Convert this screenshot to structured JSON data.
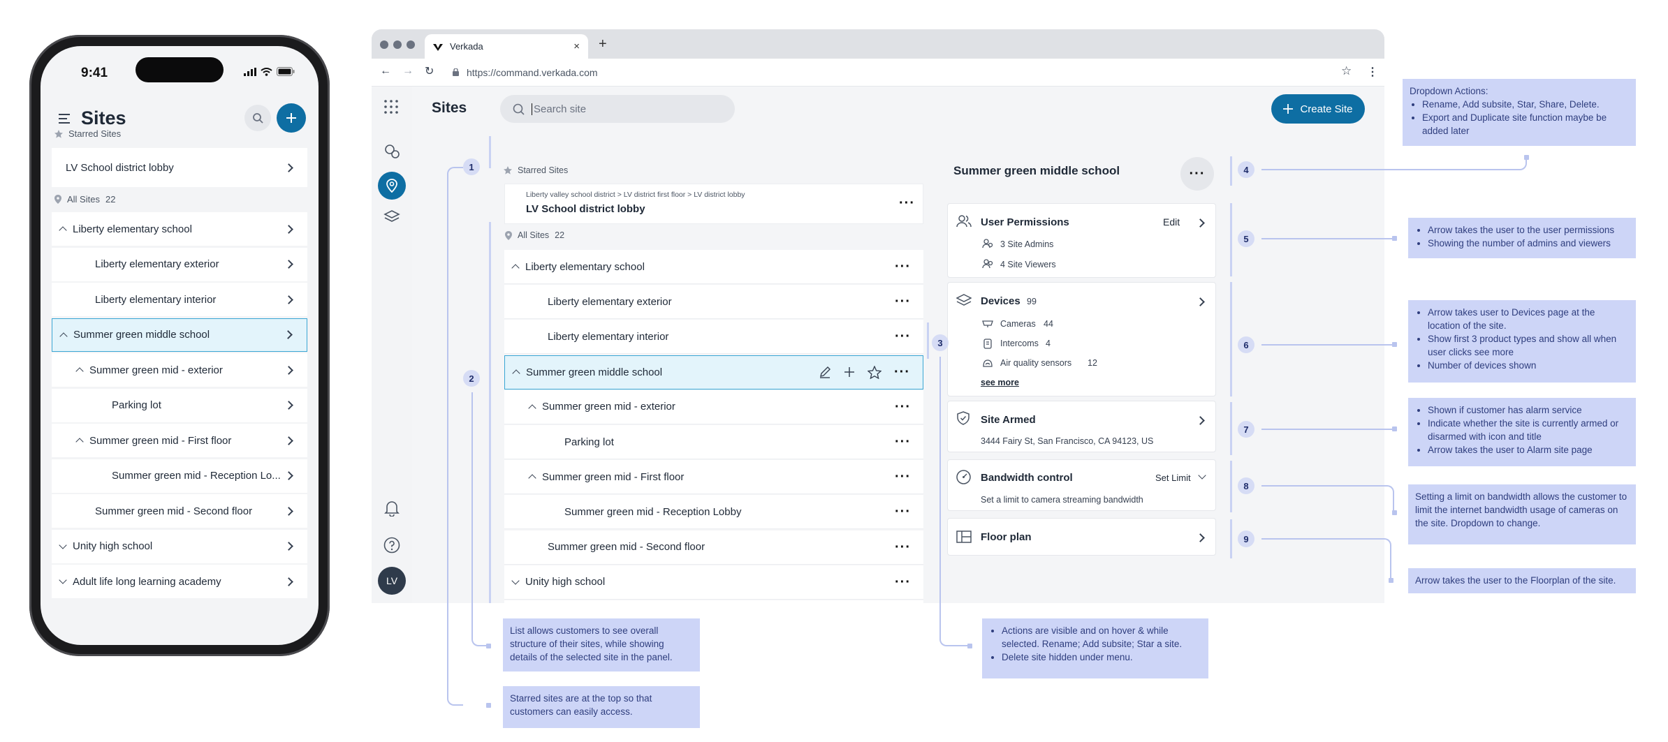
{
  "phone": {
    "time": "9:41",
    "title": "Sites",
    "starred_label": "Starred Sites",
    "starred_item": "LV School district lobby",
    "all_label": "All Sites",
    "all_count": "22",
    "items": [
      "Liberty elementary school",
      "Liberty elementary exterior",
      "Liberty elementary interior",
      "Summer green middle school",
      "Summer green mid - exterior",
      "Parking lot",
      "Summer green mid - First floor",
      "Summer green mid - Reception Lo...",
      "Summer green mid - Second floor",
      "Unity high school",
      "Adult life long learning academy"
    ]
  },
  "browser": {
    "tab_title": "Verkada",
    "url": "https://command.verkada.com",
    "page_title": "Sites",
    "search_placeholder": "Search site",
    "create_button": "Create Site",
    "avatar": "LV",
    "starred_label": "Starred Sites",
    "starred_path": "Liberty valley school district > LV district first floor > LV district lobby",
    "starred_item": "LV School district lobby",
    "all_label": "All Sites",
    "all_count": "22",
    "items": [
      "Liberty elementary school",
      "Liberty elementary exterior",
      "Liberty elementary interior",
      "Summer green middle school",
      "Summer green mid - exterior",
      "Parking lot",
      "Summer green mid - First floor",
      "Summer green mid - Reception Lobby",
      "Summer green mid - Second floor",
      "Unity high school",
      "Adult life long learning academy"
    ],
    "detail": {
      "site_name": "Summer green middle school",
      "perm_title": "User Permissions",
      "perm_edit": "Edit",
      "perm_admins": "3 Site Admins",
      "perm_viewers": "4 Site Viewers",
      "dev_title": "Devices",
      "dev_count": "99",
      "dev_cameras": "Cameras",
      "dev_cameras_n": "44",
      "dev_intercoms": "Intercoms",
      "dev_intercoms_n": "4",
      "dev_air": "Air quality sensors",
      "dev_air_n": "12",
      "dev_more": "see more",
      "armed_title": "Site Armed",
      "armed_addr": "3444 Fairy St, San Francisco, CA 94123, US",
      "bw_title": "Bandwidth control",
      "bw_action": "Set Limit",
      "bw_sub": "Set a limit to camera streaming bandwidth",
      "floor_title": "Floor plan"
    }
  },
  "markers": [
    "1",
    "2",
    "3",
    "4",
    "5",
    "6",
    "7",
    "8",
    "9"
  ],
  "notes": {
    "n4_title": "Dropdown Actions:",
    "n4_items": [
      "Rename, Add subsite, Star, Share, Delete.",
      "Export and Duplicate site function maybe be added later"
    ],
    "n5_items": [
      "Arrow takes the user to the user permissions",
      "Showing the number of admins and viewers"
    ],
    "n6_items": [
      "Arrow takes user to Devices page at the location of the site.",
      "Show first 3 product types and show all when user clicks see more",
      "Number of devices shown"
    ],
    "n7_items": [
      "Shown if customer has alarm service",
      "Indicate whether the site is currently armed or disarmed with icon and title",
      "Arrow takes the user to Alarm site page"
    ],
    "n8_text": "Setting a limit on bandwidth allows the customer to limit the internet bandwidth usage of cameras on the site. Dropdown to change.",
    "n9_text": "Arrow takes the user to the Floorplan of the site.",
    "n2_text": "List allows customers to see overall structure of their sites, while showing details of the selected site in the panel.",
    "n1_text": "Starred sites are at the top so that customers can easily access.",
    "n3_items": [
      "Actions are visible and on hover & while selected. Rename; Add subsite; Star a site.",
      "Delete site hidden under menu."
    ]
  },
  "colors": {
    "accent": "#0e6ea3",
    "selected_bg": "#e3f4fb",
    "selected_border": "#39a6d4",
    "note_bg": "#cdd5f7",
    "note_text": "#2f3e7e"
  }
}
